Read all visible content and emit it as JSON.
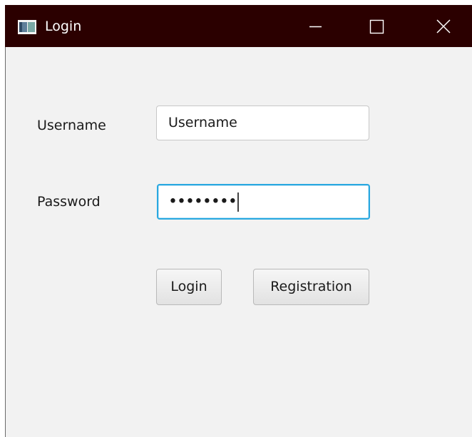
{
  "window": {
    "title": "Login",
    "icon": "app-window-icon",
    "controls": {
      "minimize": "minimize-icon",
      "maximize": "maximize-icon",
      "close": "close-icon"
    },
    "titlebar_color": "#2b0000"
  },
  "form": {
    "username_label": "Username",
    "username_value": "Username",
    "password_label": "Password",
    "password_value": "••••••••",
    "password_focus_color": "#29a8e0"
  },
  "buttons": {
    "login_label": "Login",
    "registration_label": "Registration"
  }
}
